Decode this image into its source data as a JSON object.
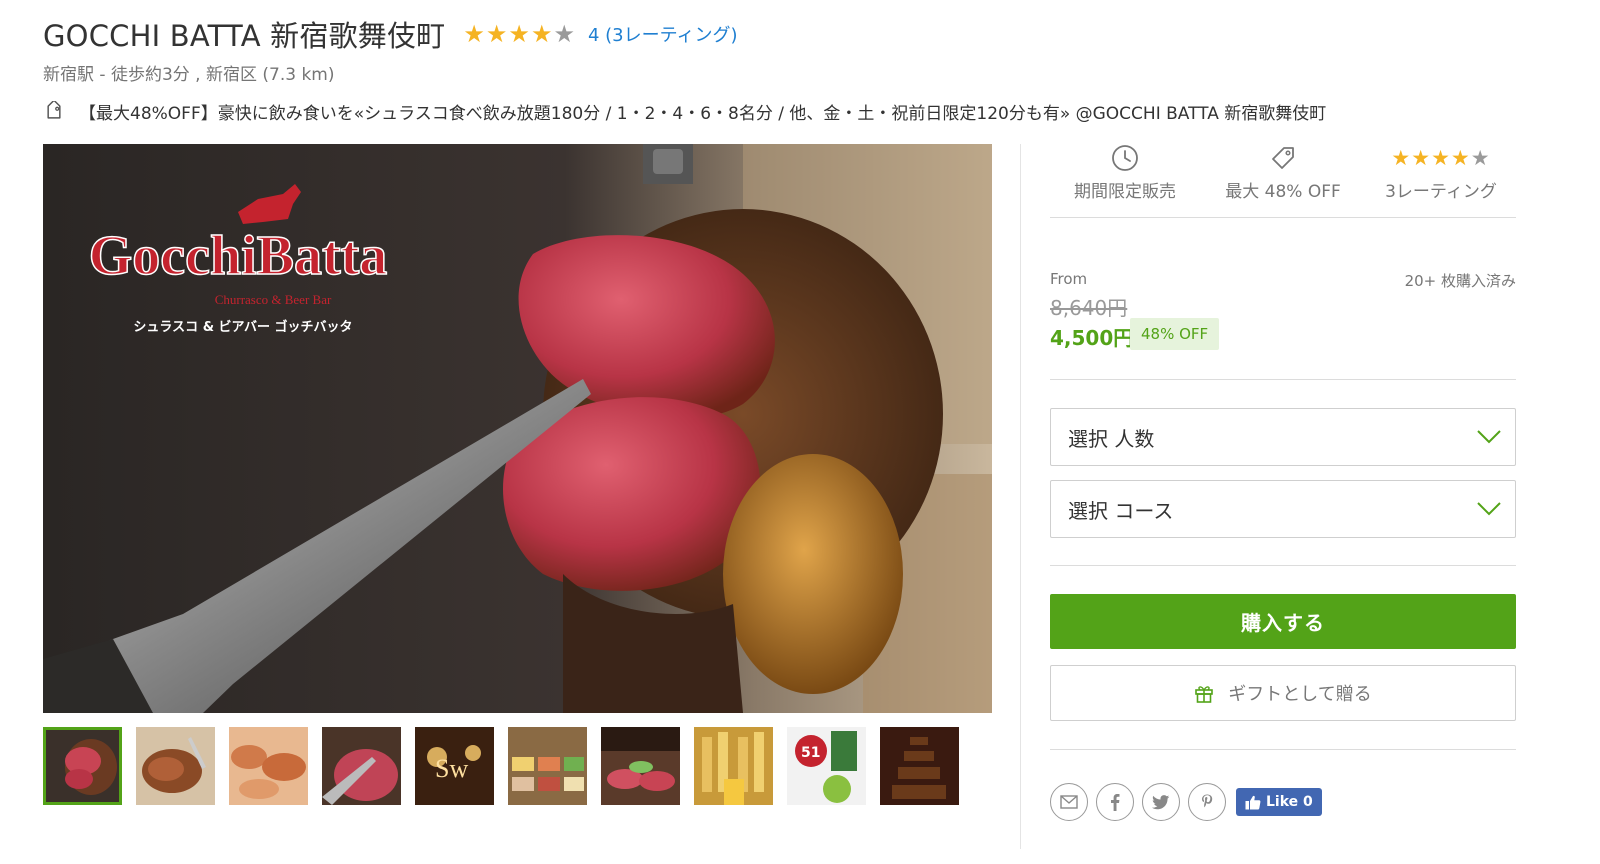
{
  "header": {
    "title": "GOCCHI BATTA 新宿歌舞伎町",
    "rating_value": 4,
    "rating_max": 5,
    "rating_link": "4 (3レーティング)",
    "location": "新宿駅 - 徒歩約3分 , 新宿区 (7.3 km)",
    "deal_title": "【最大48%OFF】豪快に飲み食いを«シュラスコ食べ飲み放題180分 / 1・2・4・6・8名分 / 他、金・土・祝前日限定120分も有» @GOCCHI BATTA 新宿歌舞伎町"
  },
  "hero": {
    "logo_main": "GocchiBatta",
    "logo_sub": "Churrasco & Beer Bar",
    "logo_jp": "シュラスコ & ビアバー ゴッチバッタ"
  },
  "thumbnails": {
    "count": 10,
    "active_index": 0
  },
  "sidebar": {
    "badges": [
      {
        "icon": "clock-icon",
        "label": "期間限定販売"
      },
      {
        "icon": "tag-icon",
        "label": "最大 48% OFF"
      },
      {
        "icon": "star-rating-icon",
        "label": "3レーティング"
      }
    ],
    "from_label": "From",
    "sold_label": "20+ 枚購入済み",
    "original_price": "8,640円",
    "sale_price": "4,500円",
    "discount_badge": "48% OFF",
    "select_people": "選択 人数",
    "select_course": "選択 コース",
    "buy_label": "購入する",
    "gift_label": "ギフトとして贈る",
    "fb_like_label": "Like 0"
  },
  "colors": {
    "accent_green": "#53a318",
    "link_blue": "#1f7fd1",
    "star_gold": "#f5b323",
    "facebook_blue": "#4267b2"
  }
}
